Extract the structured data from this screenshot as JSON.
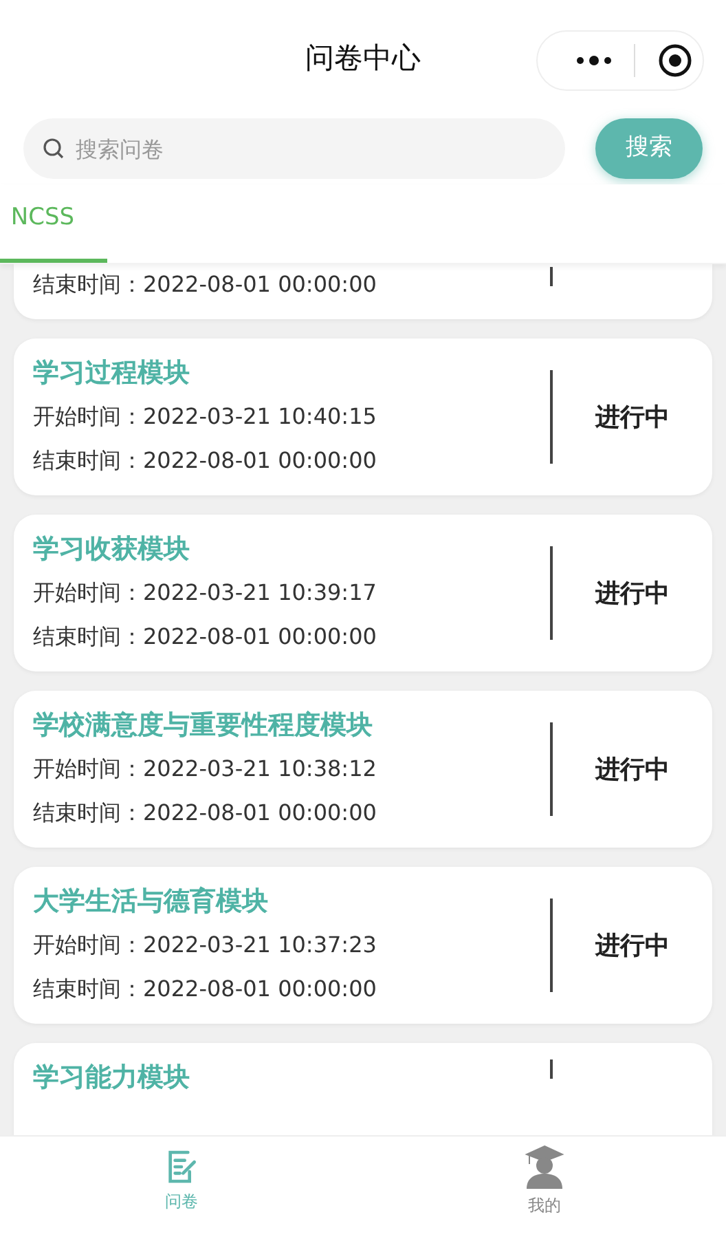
{
  "header": {
    "title": "问卷中心"
  },
  "search": {
    "placeholder": "搜索问卷",
    "button": "搜索"
  },
  "tabs": [
    {
      "label": "NCSS",
      "selected": true
    }
  ],
  "cards": [
    {
      "end": "结束时间：2022-08-01 00:00:00"
    },
    {
      "title": "学习过程模块",
      "start": "开始时间：2022-03-21 10:40:15",
      "end": "结束时间：2022-08-01 00:00:00",
      "status": "进行中"
    },
    {
      "title": "学习收获模块",
      "start": "开始时间：2022-03-21 10:39:17",
      "end": "结束时间：2022-08-01 00:00:00",
      "status": "进行中"
    },
    {
      "title": "学校满意度与重要性程度模块",
      "start": "开始时间：2022-03-21 10:38:12",
      "end": "结束时间：2022-08-01 00:00:00",
      "status": "进行中"
    },
    {
      "title": "大学生活与德育模块",
      "start": "开始时间：2022-03-21 10:37:23",
      "end": "结束时间：2022-08-01 00:00:00",
      "status": "进行中"
    },
    {
      "title": "学习能力模块"
    }
  ],
  "nav": [
    {
      "label": "问卷",
      "kind": "survey",
      "selected": true
    },
    {
      "label": "我的",
      "kind": "profile",
      "selected": false
    }
  ]
}
